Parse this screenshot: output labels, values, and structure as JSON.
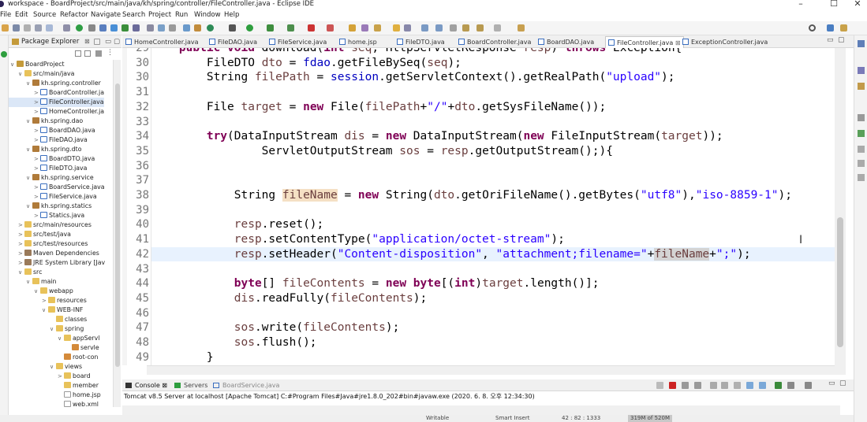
{
  "window": {
    "title": "workspace - BoardProject/src/main/java/kh/spring/controller/FileController.java - Eclipse IDE",
    "minimize": "–",
    "maximize": "☐",
    "close": "✕"
  },
  "menu": [
    "File",
    "Edit",
    "Source",
    "Refactor",
    "Navigate",
    "Search",
    "Project",
    "Run",
    "Window",
    "Help"
  ],
  "package_explorer": {
    "title": "Package Explorer",
    "tree": [
      {
        "indent": 0,
        "arrow": "∨",
        "icon": "proj",
        "label": "BoardProject"
      },
      {
        "indent": 1,
        "arrow": "∨",
        "icon": "folder",
        "label": "src/main/java"
      },
      {
        "indent": 2,
        "arrow": "∨",
        "icon": "pkg",
        "label": "kh.spring.controller"
      },
      {
        "indent": 3,
        "arrow": ">",
        "icon": "java",
        "label": "BoardController.ja"
      },
      {
        "indent": 3,
        "arrow": ">",
        "icon": "java",
        "label": "FileController.java",
        "selected": true
      },
      {
        "indent": 3,
        "arrow": ">",
        "icon": "java",
        "label": "HomeController.ja"
      },
      {
        "indent": 2,
        "arrow": "∨",
        "icon": "pkg",
        "label": "kh.spring.dao"
      },
      {
        "indent": 3,
        "arrow": ">",
        "icon": "java",
        "label": "BoardDAO.java"
      },
      {
        "indent": 3,
        "arrow": ">",
        "icon": "java",
        "label": "FileDAO.java"
      },
      {
        "indent": 2,
        "arrow": "∨",
        "icon": "pkg",
        "label": "kh.spring.dto"
      },
      {
        "indent": 3,
        "arrow": ">",
        "icon": "java",
        "label": "BoardDTO.java"
      },
      {
        "indent": 3,
        "arrow": ">",
        "icon": "java",
        "label": "FileDTO.java"
      },
      {
        "indent": 2,
        "arrow": "∨",
        "icon": "pkg",
        "label": "kh.spring.service"
      },
      {
        "indent": 3,
        "arrow": ">",
        "icon": "java",
        "label": "BoardService.java"
      },
      {
        "indent": 3,
        "arrow": ">",
        "icon": "java",
        "label": "FileService.java"
      },
      {
        "indent": 2,
        "arrow": "∨",
        "icon": "pkg",
        "label": "kh.spring.statics"
      },
      {
        "indent": 3,
        "arrow": ">",
        "icon": "java",
        "label": "Statics.java"
      },
      {
        "indent": 1,
        "arrow": ">",
        "icon": "folder",
        "label": "src/main/resources"
      },
      {
        "indent": 1,
        "arrow": ">",
        "icon": "folder",
        "label": "src/test/java"
      },
      {
        "indent": 1,
        "arrow": ">",
        "icon": "folder",
        "label": "src/test/resources"
      },
      {
        "indent": 1,
        "arrow": ">",
        "icon": "lib",
        "label": "Maven Dependencies"
      },
      {
        "indent": 1,
        "arrow": ">",
        "icon": "lib",
        "label": "JRE System Library [Jav"
      },
      {
        "indent": 1,
        "arrow": "∨",
        "icon": "folder",
        "label": "src"
      },
      {
        "indent": 2,
        "arrow": "∨",
        "icon": "folder",
        "label": "main"
      },
      {
        "indent": 3,
        "arrow": "∨",
        "icon": "folder",
        "label": "webapp"
      },
      {
        "indent": 4,
        "arrow": ">",
        "icon": "folder",
        "label": "resources"
      },
      {
        "indent": 4,
        "arrow": "∨",
        "icon": "folder",
        "label": "WEB-INF"
      },
      {
        "indent": 5,
        "arrow": "",
        "icon": "folder",
        "label": "classes"
      },
      {
        "indent": 5,
        "arrow": "∨",
        "icon": "folder",
        "label": "spring"
      },
      {
        "indent": 6,
        "arrow": "∨",
        "icon": "folder",
        "label": "appServl"
      },
      {
        "indent": 7,
        "arrow": "",
        "icon": "xml",
        "label": "servle"
      },
      {
        "indent": 6,
        "arrow": "",
        "icon": "xml",
        "label": "root-con"
      },
      {
        "indent": 5,
        "arrow": "∨",
        "icon": "folder",
        "label": "views"
      },
      {
        "indent": 6,
        "arrow": ">",
        "icon": "folder",
        "label": "board"
      },
      {
        "indent": 6,
        "arrow": "",
        "icon": "folder",
        "label": "member"
      },
      {
        "indent": 6,
        "arrow": "",
        "icon": "file",
        "label": "home.jsp"
      },
      {
        "indent": 6,
        "arrow": "",
        "icon": "file",
        "label": "web.xml"
      }
    ]
  },
  "editor_tabs": [
    {
      "label": "HomeController.java"
    },
    {
      "label": "FileDAO.java"
    },
    {
      "label": "FileService.java"
    },
    {
      "label": "home.jsp"
    },
    {
      "label": "FileDTO.java"
    },
    {
      "label": "BoardController.java"
    },
    {
      "label": "BoardDAO.java"
    },
    {
      "label": "FileController.java",
      "active": true
    },
    {
      "label": "ExceptionController.java"
    }
  ],
  "editor": {
    "lines": [
      {
        "n": "29",
        "html": "<span class=\"kw\">public void</span> download(<span class=\"kw\">int</span> <span class=\"var\">seq</span>, HttpServletResponse <span class=\"var\">resp</span>) <span class=\"kw\">throws</span> Exception{"
      },
      {
        "n": "30",
        "html": "    FileDTO <span class=\"var\">dto</span> = <span class=\"fld\">fdao</span>.getFileBySeq(<span class=\"var\">seq</span>);"
      },
      {
        "n": "30",
        "html": "    String <span class=\"var\">filePath</span> = <span class=\"fld\">session</span>.getServletContext().getRealPath(<span class=\"str\">\"upload\"</span>);"
      },
      {
        "n": "31",
        "html": ""
      },
      {
        "n": "32",
        "html": "    File <span class=\"var\">target</span> = <span class=\"kw\">new</span> File(<span class=\"var\">filePath</span>+<span class=\"str\">\"/\"</span>+<span class=\"var\">dto</span>.getSysFileName());"
      },
      {
        "n": "33",
        "html": ""
      },
      {
        "n": "34",
        "html": "    <span class=\"kw\">try</span>(DataInputStream <span class=\"var\">dis</span> = <span class=\"kw\">new</span> DataInputStream(<span class=\"kw\">new</span> FileInputStream(<span class=\"var\">target</span>));"
      },
      {
        "n": "35",
        "html": "            ServletOutputStream <span class=\"var\">sos</span> = <span class=\"var\">resp</span>.getOutputStream();){"
      },
      {
        "n": "36",
        "html": ""
      },
      {
        "n": "37",
        "html": ""
      },
      {
        "n": "38",
        "html": "        String <span class=\"hl\">fileName</span> = <span class=\"kw\">new</span> String(<span class=\"var\">dto</span>.getOriFileName().getBytes(<span class=\"str\">\"utf8\"</span>),<span class=\"str\">\"iso-8859-1\"</span>);"
      },
      {
        "n": "39",
        "html": ""
      },
      {
        "n": "40",
        "html": "        <span class=\"var\">resp</span>.reset();"
      },
      {
        "n": "41",
        "html": "        <span class=\"var\">resp</span>.setContentType(<span class=\"str\">\"application/octet-stream\"</span>);"
      },
      {
        "n": "42",
        "html": "        <span class=\"var\">resp</span>.setHeader(<span class=\"str\">\"Content-disposition\"</span>, <span class=\"str\">\"attachment;filename=\"</span>+<span class=\"hl2\">fileName</span>+<span class=\"str\">\";\"</span>);",
        "current": true
      },
      {
        "n": "43",
        "html": ""
      },
      {
        "n": "44",
        "html": "        <span class=\"kw\">byte</span>[] <span class=\"var\">fileContents</span> = <span class=\"kw\">new byte</span>[(<span class=\"kw\">int</span>)<span class=\"var\">target</span>.length()];"
      },
      {
        "n": "45",
        "html": "        <span class=\"var\">dis</span>.readFully(<span class=\"var\">fileContents</span>);"
      },
      {
        "n": "46",
        "html": ""
      },
      {
        "n": "47",
        "html": "        <span class=\"var\">sos</span>.write(<span class=\"var\">fileContents</span>);"
      },
      {
        "n": "48",
        "html": "        <span class=\"var\">sos</span>.flush();"
      },
      {
        "n": "49",
        "html": "    }"
      }
    ]
  },
  "bottom_panel": {
    "tabs": [
      {
        "label": "Console ⊠",
        "active": true
      },
      {
        "label": "Servers"
      },
      {
        "label": "BoardService.java"
      }
    ],
    "console_text": "Tomcat v8.5 Server at localhost [Apache Tomcat] C:#Program Files#Java#jre1.8.0_202#bin#javaw.exe (2020. 6. 8. 오후 12:34:30)"
  },
  "statusbar": {
    "writable": "Writable",
    "insert_mode": "Smart Insert",
    "position": "42 : 82 : 1333",
    "memory": "319M of 520M"
  },
  "colors": {
    "keyword": "#7f0055",
    "string": "#2a00ff",
    "field": "#0000c0",
    "local": "#6a3e3e",
    "current_line": "#e8f2fe"
  }
}
